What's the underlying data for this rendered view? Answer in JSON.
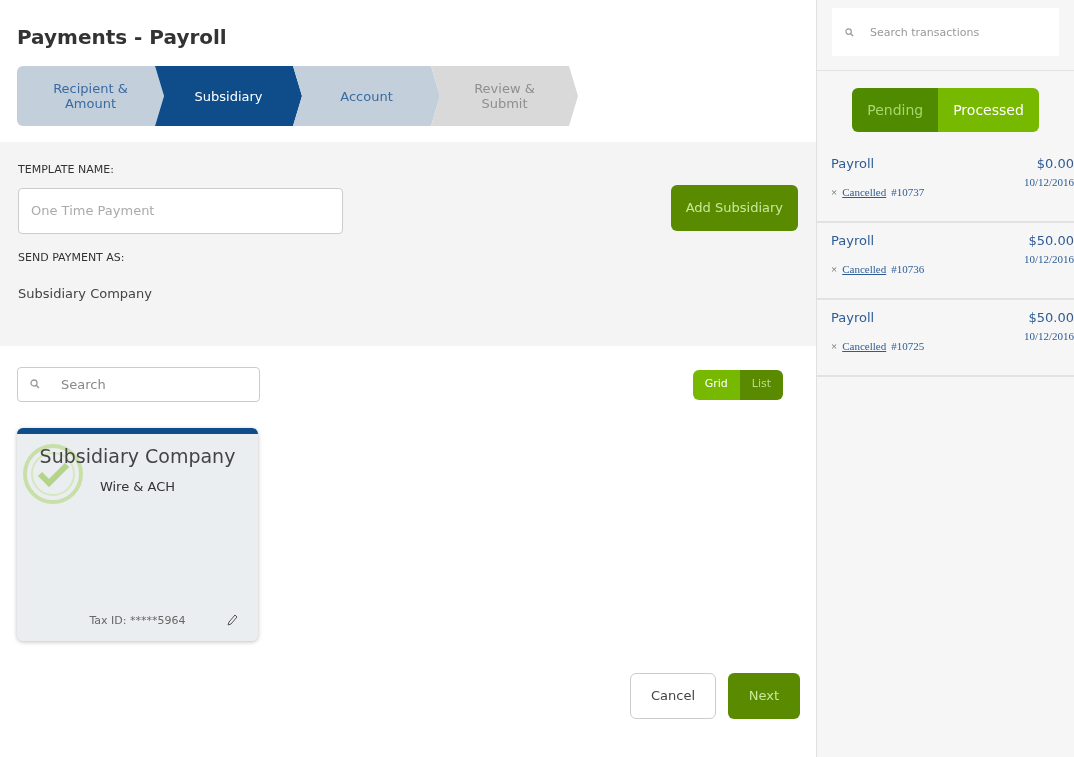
{
  "page_title": "Payments - Payroll",
  "steps": [
    {
      "label": "Recipient & Amount",
      "selected": false,
      "disabled": false
    },
    {
      "label": "Subsidiary",
      "selected": true,
      "disabled": false
    },
    {
      "label": "Account",
      "selected": false,
      "disabled": false
    },
    {
      "label": "Review & Submit",
      "selected": false,
      "disabled": true
    }
  ],
  "form": {
    "template_label": "TEMPLATE NAME:",
    "template_placeholder": "One Time Payment",
    "add_button": "Add Subsidiary",
    "send_label": "SEND PAYMENT AS:",
    "send_value": "Subsidiary Company"
  },
  "search": {
    "placeholder": "Search"
  },
  "view_toggle": [
    {
      "label": "Grid",
      "selected": true
    },
    {
      "label": "List",
      "selected": false
    }
  ],
  "cards": [
    {
      "name": "Subsidiary Company",
      "type": "Wire & ACH",
      "tax_id": "Tax ID: *****5964",
      "selected": true
    }
  ],
  "buttons": {
    "cancel": "Cancel",
    "next": "Next"
  },
  "sidebar": {
    "search_placeholder": "Search transactions",
    "tabs": [
      {
        "label": "Pending",
        "selected": false
      },
      {
        "label": "Processed",
        "selected": true
      }
    ],
    "transactions": [
      {
        "name": "Payroll",
        "amount": "$0.00",
        "date": "10/12/2016",
        "mark": "×",
        "status": "Cancelled",
        "number": "#10737"
      },
      {
        "name": "Payroll",
        "amount": "$50.00",
        "date": "10/12/2016",
        "mark": "×",
        "status": "Cancelled",
        "number": "#10736"
      },
      {
        "name": "Payroll",
        "amount": "$50.00",
        "date": "10/12/2016",
        "mark": "×",
        "status": "Cancelled",
        "number": "#10725"
      }
    ]
  }
}
